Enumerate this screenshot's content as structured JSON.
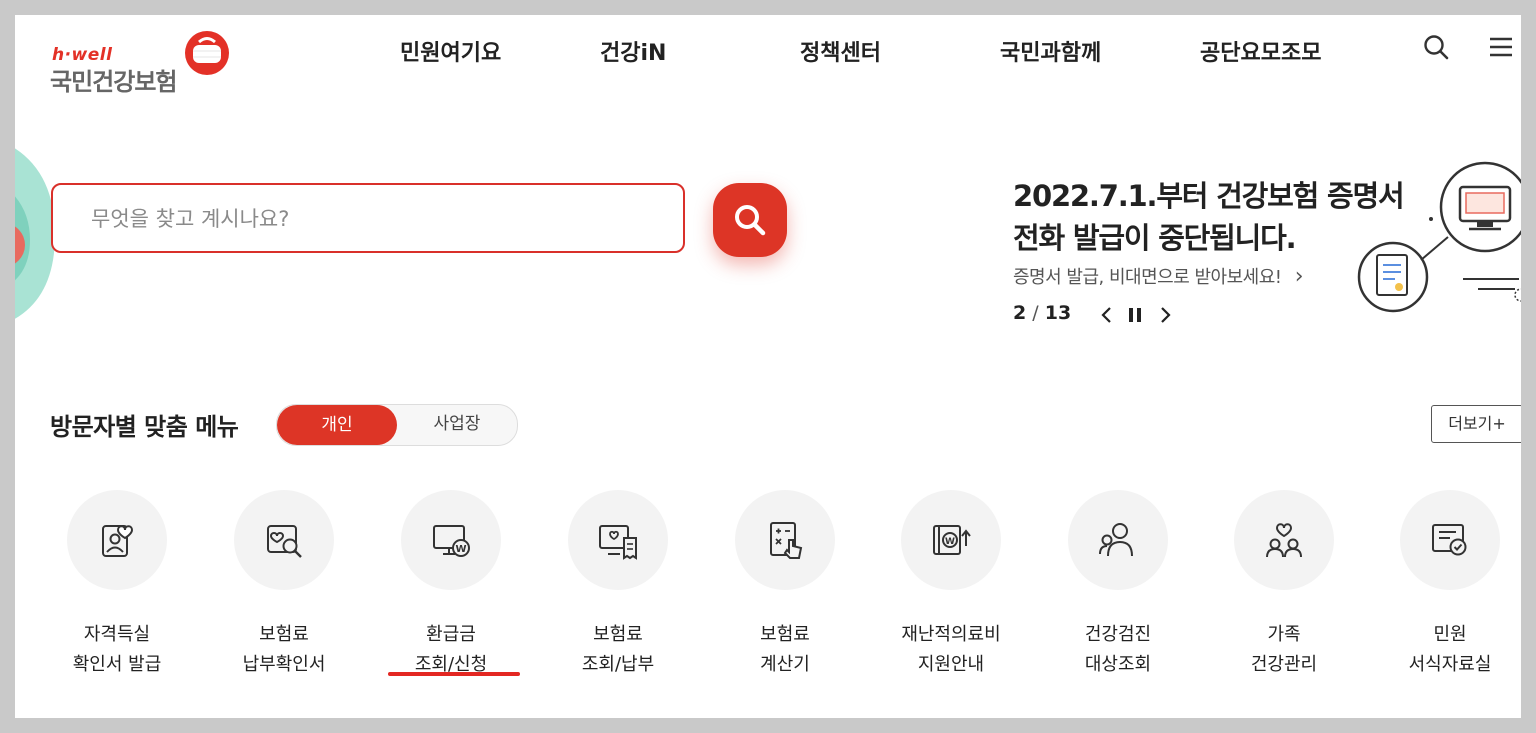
{
  "header": {
    "logo_hwell": "h·well",
    "logo_name": "국민건강보험",
    "nav": [
      "민원여기요",
      "건강iN",
      "정책센터",
      "국민과함께",
      "공단요모조모"
    ]
  },
  "search": {
    "placeholder": "무엇을 찾고 계시나요?"
  },
  "banner": {
    "title_line1": "2022.7.1.부터 건강보험 증명서",
    "title_line2": "전화 발급이 중단됩니다.",
    "subtitle": "증명서 발급, 비대면으로 받아보세요!",
    "subtitle_arrow": "›",
    "pager_current": "2",
    "pager_sep": "/",
    "pager_total": "13"
  },
  "visitor_menu": {
    "title": "방문자별 맞춤 메뉴",
    "toggle_selected": "개인",
    "toggle_other": "사업장",
    "more": "더보기+"
  },
  "quick_menu": [
    {
      "line1": "자격득실",
      "line2": "확인서 발급",
      "icon": "person-heart-card-icon"
    },
    {
      "line1": "보험료",
      "line2": "납부확인서",
      "icon": "heart-search-icon"
    },
    {
      "line1": "환급금",
      "line2": "조회/신청",
      "icon": "monitor-won-icon"
    },
    {
      "line1": "보험료",
      "line2": "조회/납부",
      "icon": "monitor-heart-receipt-icon"
    },
    {
      "line1": "보험료",
      "line2": "계산기",
      "icon": "calculator-hand-icon"
    },
    {
      "line1": "재난적의료비",
      "line2": "지원안내",
      "icon": "book-won-arrow-icon"
    },
    {
      "line1": "건강검진",
      "line2": "대상조회",
      "icon": "group-search-icon"
    },
    {
      "line1": "가족",
      "line2": "건강관리",
      "icon": "family-heart-icon"
    },
    {
      "line1": "민원",
      "line2": "서식자료실",
      "icon": "document-check-icon"
    }
  ],
  "colors": {
    "accent": "#dd3526",
    "underline": "#e32722",
    "icon_circle": "#f3f3f3",
    "frame": "#c9c9c9"
  }
}
